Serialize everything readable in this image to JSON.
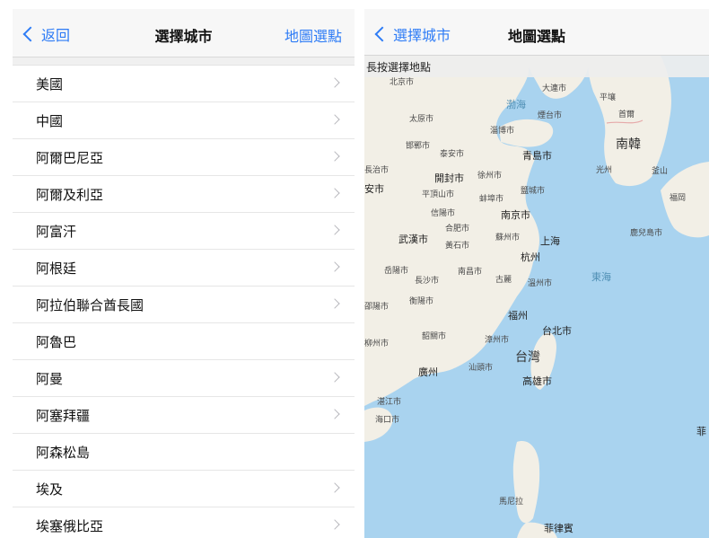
{
  "left": {
    "nav": {
      "back_label": "返回",
      "title": "選擇城市",
      "action_label": "地圖選點"
    },
    "rows": [
      {
        "label": "美國",
        "chevron": true
      },
      {
        "label": "中國",
        "chevron": true
      },
      {
        "label": "阿爾巴尼亞",
        "chevron": true
      },
      {
        "label": "阿爾及利亞",
        "chevron": true
      },
      {
        "label": "阿富汗",
        "chevron": true
      },
      {
        "label": "阿根廷",
        "chevron": true
      },
      {
        "label": "阿拉伯聯合酋長國",
        "chevron": true
      },
      {
        "label": "阿魯巴",
        "chevron": false
      },
      {
        "label": "阿曼",
        "chevron": true
      },
      {
        "label": "阿塞拜疆",
        "chevron": true
      },
      {
        "label": "阿森松島",
        "chevron": false
      },
      {
        "label": "埃及",
        "chevron": true
      },
      {
        "label": "埃塞俄比亞",
        "chevron": true
      }
    ]
  },
  "right": {
    "nav": {
      "back_label": "選擇城市",
      "title": "地圖選點"
    },
    "hint": "長按選擇地點",
    "map": {
      "labels": {
        "beijing": "北京市",
        "dalian": "大連市",
        "pyongyang": "平壤",
        "seoul": "首爾",
        "bohai": "渤海",
        "taiyuan": "太原市",
        "yantai": "煙台市",
        "zibo": "淄博市",
        "handan": "邯鄲市",
        "taian": "泰安市",
        "qingdao": "青島市",
        "south_korea": "南韓",
        "gwangju": "光州",
        "busan": "釜山",
        "changzhi": "長治市",
        "kaifeng": "開封市",
        "xuzhou": "徐州市",
        "xian": "安市",
        "pingdingshan": "平頂山市",
        "bengbu": "蚌埠市",
        "yancheng": "鹽城市",
        "fukuoka": "福岡",
        "xinyang": "信陽市",
        "nanjing": "南京市",
        "hefei": "合肥市",
        "wuhan": "武漢市",
        "huangshi": "黃石市",
        "suzhou": "蘇州市",
        "shanghai": "上海",
        "kagoshima": "鹿兒島市",
        "hangzhou": "杭州",
        "yueyang": "岳陽市",
        "changsha": "長沙市",
        "nanchang": "南昌市",
        "lishui": "古麗",
        "wenzhou": "溫州市",
        "east_sea": "東海",
        "shaoyang": "邵陽市",
        "hengyang": "衡陽市",
        "fuzhou": "福州",
        "taipei": "台北市",
        "liuzhou": "柳州市",
        "shaoguan": "韶關市",
        "zhangzhou": "漳州市",
        "taiwan": "台灣",
        "guangzhou": "廣州",
        "shantou": "汕頭市",
        "kaohsiung": "高雄市",
        "zhanjiang": "湛江市",
        "haikou": "海口市",
        "luzon_edge": "菲",
        "manila": "馬尼拉",
        "philippines": "菲律賓"
      }
    }
  },
  "colors": {
    "accent": "#2e7cf6",
    "sea": "#a9d3ef",
    "land": "#f2efe6",
    "chevron": "#b8b8bd"
  }
}
